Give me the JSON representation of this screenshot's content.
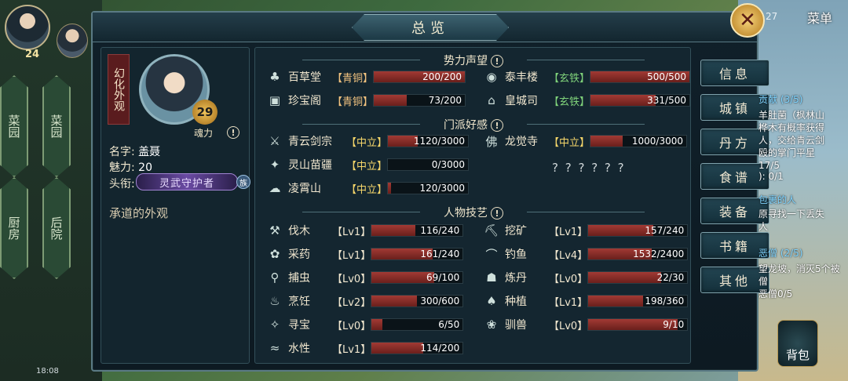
{
  "panel": {
    "title": "总览"
  },
  "character": {
    "banner": "幻化外观",
    "level": "29",
    "soul_label": "魂力",
    "name_label": "名字:",
    "name_value": "盖聂",
    "charm_label": "魅力:",
    "charm_value": "20",
    "title_label": "头衔:",
    "title_value": "灵武守护者",
    "title_badge": "族",
    "appearance": "承道的外观"
  },
  "sections": {
    "reputation": "势力声望",
    "sect": "门派好感",
    "skills": "人物技艺"
  },
  "reputation": [
    {
      "icon": "leaf-icon",
      "glyph": "♣",
      "name": "百草堂",
      "tier": "【青铜】",
      "tier_type": "bronze",
      "value": 200,
      "max": 200,
      "text": "200/200"
    },
    {
      "icon": "chest-icon",
      "glyph": "▣",
      "name": "珍宝阁",
      "tier": "【青铜】",
      "tier_type": "bronze",
      "value": 73,
      "max": 200,
      "text": "73/200"
    },
    {
      "icon": "bowl-icon",
      "glyph": "◉",
      "name": "泰丰楼",
      "tier": "【玄铁】",
      "tier_type": "iron",
      "value": 500,
      "max": 500,
      "text": "500/500"
    },
    {
      "icon": "palace-icon",
      "glyph": "⌂",
      "name": "皇城司",
      "tier": "【玄铁】",
      "tier_type": "iron",
      "value": 331,
      "max": 500,
      "text": "331/500"
    }
  ],
  "sect": [
    {
      "icon": "sword-sect-icon",
      "glyph": "⚔",
      "name": "青云剑宗",
      "tier": "【中立】",
      "value": 1120,
      "max": 3000,
      "text": "1120/3000"
    },
    {
      "icon": "butterfly-icon",
      "glyph": "✦",
      "name": "灵山苗疆",
      "tier": "【中立】",
      "value": 0,
      "max": 3000,
      "text": "0/3000"
    },
    {
      "icon": "cloud-icon",
      "glyph": "☁",
      "name": "凌霄山",
      "tier": "【中立】",
      "value": 120,
      "max": 3000,
      "text": "120/3000"
    },
    {
      "icon": "buddha-icon",
      "glyph": "佛",
      "name": "龙觉寺",
      "tier": "【中立】",
      "value": 1000,
      "max": 3000,
      "text": "1000/3000"
    }
  ],
  "unknown_sect": "? ? ? ? ? ?",
  "skills": [
    {
      "icon": "axe-icon",
      "glyph": "⚒",
      "name": "伐木",
      "lv": "【Lv1】",
      "value": 116,
      "max": 240,
      "text": "116/240"
    },
    {
      "icon": "herb-icon",
      "glyph": "✿",
      "name": "采药",
      "lv": "【Lv1】",
      "value": 161,
      "max": 240,
      "text": "161/240"
    },
    {
      "icon": "net-icon",
      "glyph": "⚲",
      "name": "捕虫",
      "lv": "【Lv0】",
      "value": 69,
      "max": 100,
      "text": "69/100"
    },
    {
      "icon": "cooking-icon",
      "glyph": "♨",
      "name": "烹饪",
      "lv": "【Lv2】",
      "value": 300,
      "max": 600,
      "text": "300/600"
    },
    {
      "icon": "treasure-icon",
      "glyph": "✧",
      "name": "寻宝",
      "lv": "【Lv0】",
      "value": 6,
      "max": 50,
      "text": "6/50"
    },
    {
      "icon": "water-icon",
      "glyph": "≈",
      "name": "水性",
      "lv": "【Lv1】",
      "value": 114,
      "max": 200,
      "text": "114/200"
    },
    {
      "icon": "pickaxe-icon",
      "glyph": "⛏",
      "name": "挖矿",
      "lv": "【Lv1】",
      "value": 157,
      "max": 240,
      "text": "157/240"
    },
    {
      "icon": "fishing-icon",
      "glyph": "⌒",
      "name": "钓鱼",
      "lv": "【Lv4】",
      "value": 1532,
      "max": 2400,
      "text": "1532/2400"
    },
    {
      "icon": "alchemy-icon",
      "glyph": "☗",
      "name": "炼丹",
      "lv": "【Lv0】",
      "value": 22,
      "max": 30,
      "text": "22/30"
    },
    {
      "icon": "sprout-icon",
      "glyph": "♠",
      "name": "种植",
      "lv": "【Lv1】",
      "value": 198,
      "max": 360,
      "text": "198/360"
    },
    {
      "icon": "paw-icon",
      "glyph": "❀",
      "name": "驯兽",
      "lv": "【Lv0】",
      "value": 9,
      "max": 10,
      "text": "9/10"
    }
  ],
  "menu": [
    "信息",
    "城镇",
    "丹方",
    "食谱",
    "装备",
    "书籍",
    "其他"
  ],
  "top_right": {
    "menu_label": "菜单",
    "num": "27"
  },
  "hud": {
    "avatar_level": "24",
    "clock": "18:08"
  },
  "map_buildings": [
    "菜园",
    "菜园",
    "厨房",
    "后院"
  ],
  "side": {
    "bag": "背包",
    "lines": [
      "贡献 (3/5)",
      "羊肚菌（枫林山",
      "桦木有概率获得",
      "人，交给青云剑",
      "殴的掌门平星",
      "17/5",
      "): 0/1",
      "包裹的人",
      "原寻找一下丢失",
      "人",
      "恶僧 (2/5)",
      "望龙坡，消灭5个被",
      "僧",
      "恶僧0/5"
    ]
  }
}
